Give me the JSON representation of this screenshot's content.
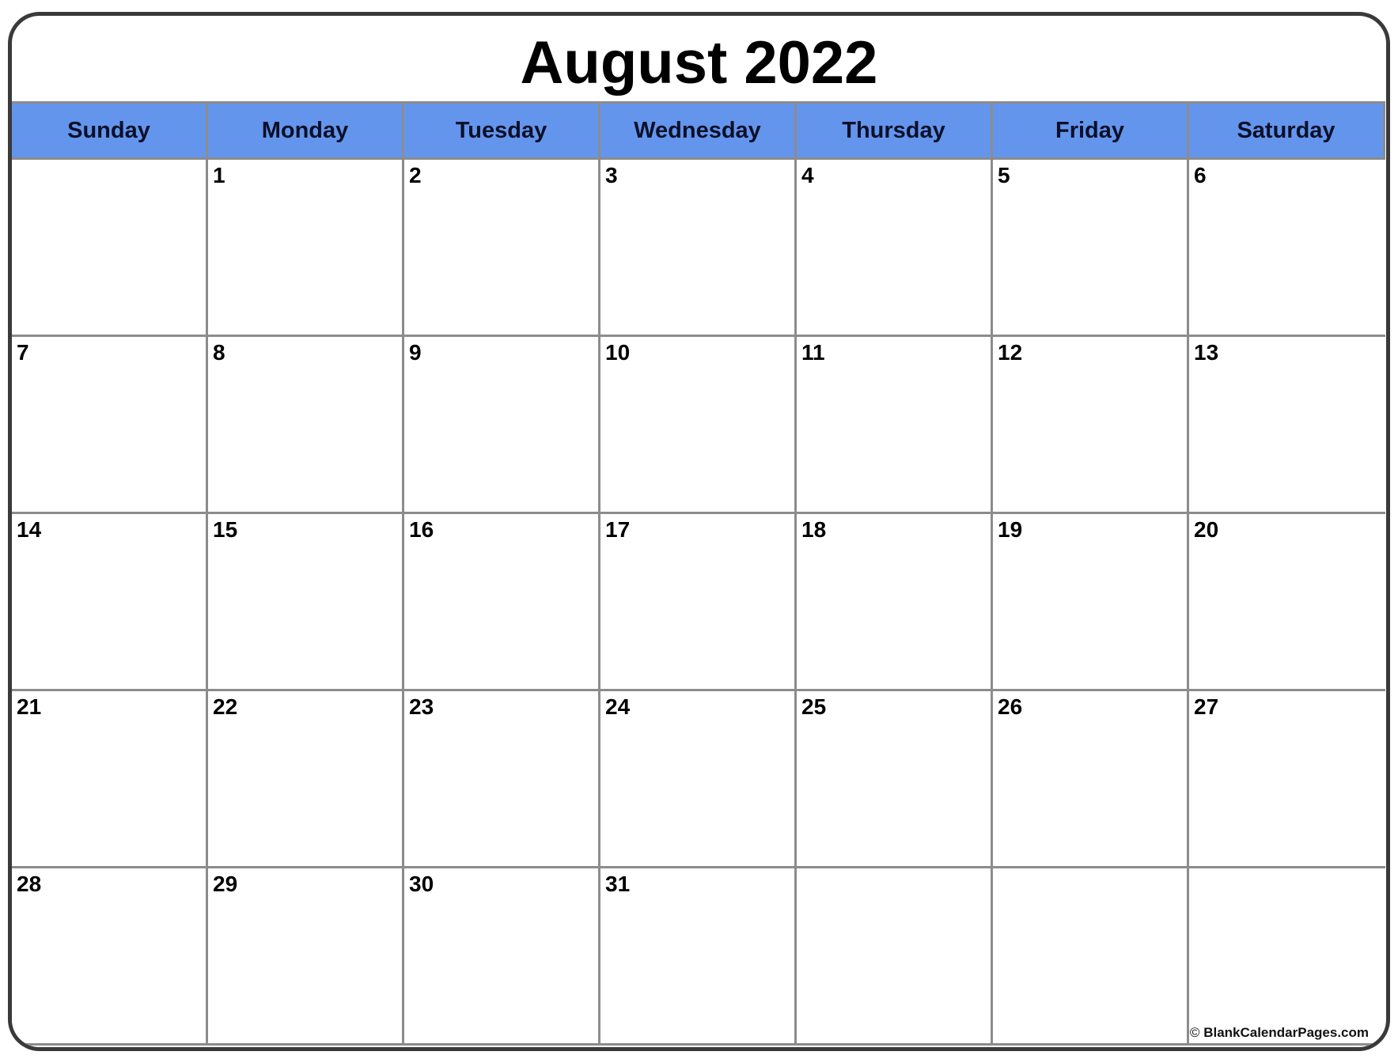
{
  "title": "August 2022",
  "header_color": "#6495ED",
  "weekdays": [
    "Sunday",
    "Monday",
    "Tuesday",
    "Wednesday",
    "Thursday",
    "Friday",
    "Saturday"
  ],
  "weeks": [
    [
      "",
      "1",
      "2",
      "3",
      "4",
      "5",
      "6"
    ],
    [
      "7",
      "8",
      "9",
      "10",
      "11",
      "12",
      "13"
    ],
    [
      "14",
      "15",
      "16",
      "17",
      "18",
      "19",
      "20"
    ],
    [
      "21",
      "22",
      "23",
      "24",
      "25",
      "26",
      "27"
    ],
    [
      "28",
      "29",
      "30",
      "31",
      "",
      "",
      ""
    ]
  ],
  "footer": {
    "copyright_symbol": "©",
    "text": "BlankCalendarPages.com"
  }
}
